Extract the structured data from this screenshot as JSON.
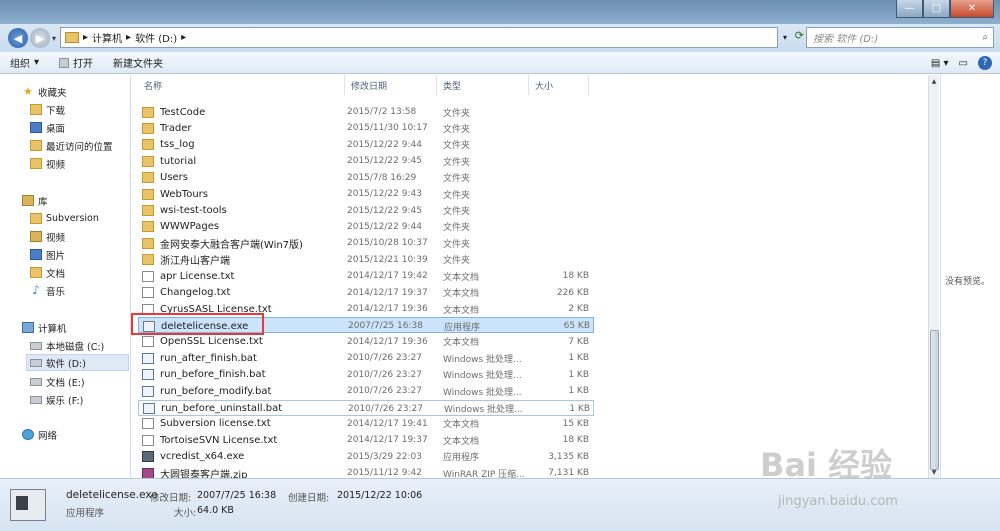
{
  "window": {
    "minimize": "—",
    "maximize": "□",
    "close": "✕"
  },
  "address": {
    "back_icon": "back-arrow-icon",
    "crumbs": [
      "计算机",
      "软件 (D:)"
    ],
    "separator": "▸",
    "search_placeholder": "搜索 软件 (D:)"
  },
  "toolbar": {
    "organize": "组织",
    "open": "打开",
    "new_folder": "新建文件夹"
  },
  "columns": {
    "name": "名称",
    "date": "修改日期",
    "type": "类型",
    "size": "大小"
  },
  "nav": {
    "favorites": "收藏夹",
    "downloads": "下载",
    "desktop": "桌面",
    "recent": "最近访问的位置",
    "videos_fav": "视频",
    "libraries": "库",
    "subversion": "Subversion",
    "videos": "视频",
    "pictures": "图片",
    "documents": "文档",
    "music": "音乐",
    "computer": "计算机",
    "drive_c": "本地磁盘 (C:)",
    "drive_d": "软件 (D:)",
    "drive_e": "文档 (E:)",
    "drive_f": "娱乐 (F:)",
    "network": "网络"
  },
  "files": [
    {
      "name": "TestCode",
      "date": "2015/7/2 13:58",
      "type": "文件夹",
      "size": "",
      "icon": "folder"
    },
    {
      "name": "Trader",
      "date": "2015/11/30 10:17",
      "type": "文件夹",
      "size": "",
      "icon": "folder"
    },
    {
      "name": "tss_log",
      "date": "2015/12/22 9:44",
      "type": "文件夹",
      "size": "",
      "icon": "folder"
    },
    {
      "name": "tutorial",
      "date": "2015/12/22 9:45",
      "type": "文件夹",
      "size": "",
      "icon": "folder"
    },
    {
      "name": "Users",
      "date": "2015/7/8 16:29",
      "type": "文件夹",
      "size": "",
      "icon": "folder"
    },
    {
      "name": "WebTours",
      "date": "2015/12/22 9:43",
      "type": "文件夹",
      "size": "",
      "icon": "folder"
    },
    {
      "name": "wsi-test-tools",
      "date": "2015/12/22 9:45",
      "type": "文件夹",
      "size": "",
      "icon": "folder"
    },
    {
      "name": "WWWPages",
      "date": "2015/12/22 9:44",
      "type": "文件夹",
      "size": "",
      "icon": "folder"
    },
    {
      "name": "金网安泰大融合客户端(Win7版)",
      "date": "2015/10/28 10:37",
      "type": "文件夹",
      "size": "",
      "icon": "folder"
    },
    {
      "name": "浙江舟山客户端",
      "date": "2015/12/21 10:39",
      "type": "文件夹",
      "size": "",
      "icon": "folder"
    },
    {
      "name": "apr License.txt",
      "date": "2014/12/17 19:42",
      "type": "文本文档",
      "size": "18 KB",
      "icon": "txt"
    },
    {
      "name": "Changelog.txt",
      "date": "2014/12/17 19:37",
      "type": "文本文档",
      "size": "226 KB",
      "icon": "txt"
    },
    {
      "name": "CyrusSASL License.txt",
      "date": "2014/12/17 19:36",
      "type": "文本文档",
      "size": "2 KB",
      "icon": "txt"
    },
    {
      "name": "deletelicense.exe",
      "date": "2007/7/25 16:38",
      "type": "应用程序",
      "size": "65 KB",
      "icon": "exe"
    },
    {
      "name": "OpenSSL License.txt",
      "date": "2014/12/17 19:36",
      "type": "文本文档",
      "size": "7 KB",
      "icon": "txt"
    },
    {
      "name": "run_after_finish.bat",
      "date": "2010/7/26 23:27",
      "type": "Windows 批处理...",
      "size": "1 KB",
      "icon": "bat"
    },
    {
      "name": "run_before_finish.bat",
      "date": "2010/7/26 23:27",
      "type": "Windows 批处理...",
      "size": "1 KB",
      "icon": "bat"
    },
    {
      "name": "run_before_modify.bat",
      "date": "2010/7/26 23:27",
      "type": "Windows 批处理...",
      "size": "1 KB",
      "icon": "bat"
    },
    {
      "name": "run_before_uninstall.bat",
      "date": "2010/7/26 23:27",
      "type": "Windows 批处理...",
      "size": "1 KB",
      "icon": "bat"
    },
    {
      "name": "Subversion license.txt",
      "date": "2014/12/17 19:41",
      "type": "文本文档",
      "size": "15 KB",
      "icon": "txt"
    },
    {
      "name": "TortoiseSVN License.txt",
      "date": "2014/12/17 19:37",
      "type": "文本文档",
      "size": "18 KB",
      "icon": "txt"
    },
    {
      "name": "vcredist_x64.exe",
      "date": "2015/3/29 22:03",
      "type": "应用程序",
      "size": "3,135 KB",
      "icon": "vc"
    },
    {
      "name": "大圆银泰客户端.zip",
      "date": "2015/11/12 9:42",
      "type": "WinRAR ZIP 压缩...",
      "size": "7,131 KB",
      "icon": "zip"
    }
  ],
  "preview": {
    "empty_text": "没有预览。"
  },
  "status": {
    "filename": "deletelicense.exe",
    "modified_label": "修改日期:",
    "modified_value": "2007/7/25 16:38",
    "created_label": "创建日期:",
    "created_value": "2015/12/22 10:06",
    "type": "应用程序",
    "size_label": "大小:",
    "size_value": "64.0 KB"
  },
  "watermark": {
    "brand": "Bai 经验",
    "url": "jingyan.baidu.com"
  },
  "selected_file": "deletelicense.exe"
}
